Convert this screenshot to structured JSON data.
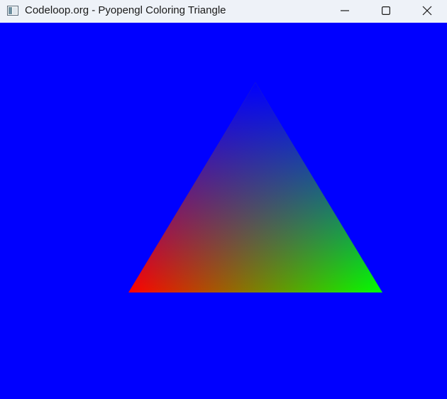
{
  "window": {
    "title": "Codeloop.org - Pyopengl Coloring Triangle",
    "controls": {
      "minimize_icon": "minimize-icon",
      "maximize_icon": "maximize-icon",
      "close_icon": "close-icon"
    }
  },
  "scene": {
    "clear_color": "#0000ff",
    "vertex_colors": {
      "left": "#ff0000",
      "right": "#00ff00",
      "top": "#0000ff"
    }
  }
}
